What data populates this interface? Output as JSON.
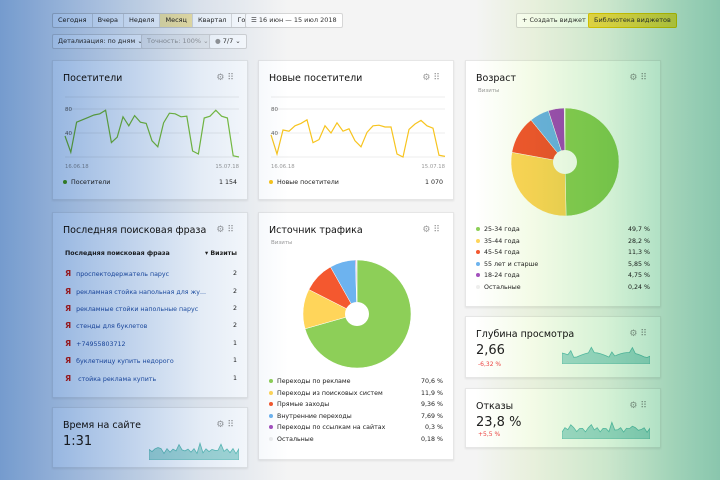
{
  "toolbar": {
    "periods": [
      "Сегодня",
      "Вчера",
      "Неделя",
      "Месяц",
      "Квартал",
      "Год"
    ],
    "active_period": "Месяц",
    "date_range": "16 июн — 15 июл 2018",
    "create_widget": "Создать виджет",
    "library": "Библиотека виджетов",
    "detail": "Детализация: по дням",
    "accuracy": "Точность: 100%",
    "segments": "7/7"
  },
  "visitors": {
    "title": "Посетители",
    "y_ticks": [
      "80",
      "40"
    ],
    "x_start": "16.06.18",
    "x_end": "15.07.18",
    "legend": "Посетители",
    "total": "1 154",
    "color": "#7cc243",
    "values": [
      35,
      8,
      58,
      62,
      66,
      70,
      72,
      78,
      24,
      33,
      67,
      52,
      69,
      58,
      56,
      27,
      17,
      57,
      73,
      72,
      67,
      68,
      10,
      5,
      65,
      68,
      78,
      68,
      65,
      2,
      0
    ]
  },
  "new_visitors": {
    "title": "Новые посетители",
    "y_ticks": [
      "80",
      "40"
    ],
    "x_start": "16.06.18",
    "x_end": "15.07.18",
    "legend": "Новые посетители",
    "total": "1 070",
    "color": "#f7c41f",
    "values": [
      37,
      5,
      45,
      43,
      52,
      56,
      62,
      24,
      29,
      52,
      40,
      57,
      43,
      47,
      27,
      17,
      41,
      52,
      53,
      50,
      50,
      5,
      0,
      46,
      55,
      61,
      52,
      48,
      3,
      1
    ]
  },
  "search": {
    "title": "Последняя поисковая фраза",
    "col_phrase": "Последняя поисковая фраза",
    "col_visits": "▾ Визиты",
    "rows": [
      {
        "phrase": "проспектодержатель парус",
        "visits": "2"
      },
      {
        "phrase": "рекламная стойка напольная для жу...",
        "visits": "2"
      },
      {
        "phrase": "рекламные стойки напольные парус",
        "visits": "2"
      },
      {
        "phrase": "стенды для буклетов",
        "visits": "2"
      },
      {
        "phrase": "+74955803712",
        "visits": "1"
      },
      {
        "phrase": "буклетницу купить недорого",
        "visits": "1"
      },
      {
        "phrase": " стойка реклама купить",
        "visits": "1"
      }
    ]
  },
  "time": {
    "title": "Время на сайте",
    "value": "1:31"
  },
  "traffic": {
    "title": "Источник трафика",
    "subtitle": "Визиты",
    "items": [
      {
        "label": "Переходы по рекламе",
        "value": "70,6 %",
        "pct": 70.6,
        "color": "#8dcf58"
      },
      {
        "label": "Переходы из поисковых систем",
        "value": "11,9 %",
        "pct": 11.9,
        "color": "#ffd55a"
      },
      {
        "label": "Прямые заходы",
        "value": "9,36 %",
        "pct": 9.36,
        "color": "#f4582f"
      },
      {
        "label": "Внутренние переходы",
        "value": "7,69 %",
        "pct": 7.69,
        "color": "#6db3ef"
      },
      {
        "label": "Переходы по ссылкам на сайтах",
        "value": "0,3 %",
        "pct": 0.3,
        "color": "#a351be"
      },
      {
        "label": "Остальные",
        "value": "0,18 %",
        "pct": 0.18,
        "color": "#eeeeee"
      }
    ]
  },
  "age": {
    "title": "Возраст",
    "subtitle": "Визиты",
    "items": [
      {
        "label": "25-34 года",
        "value": "49,7 %",
        "pct": 49.7,
        "color": "#8dcf58"
      },
      {
        "label": "35-44 года",
        "value": "28,2 %",
        "pct": 28.2,
        "color": "#ffd55a"
      },
      {
        "label": "45-54 года",
        "value": "11,3 %",
        "pct": 11.3,
        "color": "#f4582f"
      },
      {
        "label": "55 лет и старше",
        "value": "5,85 %",
        "pct": 5.85,
        "color": "#6db3ef"
      },
      {
        "label": "18-24 года",
        "value": "4,75 %",
        "pct": 4.75,
        "color": "#a351be"
      },
      {
        "label": "Остальные",
        "value": "0,24 %",
        "pct": 0.24,
        "color": "#eeeeee"
      }
    ]
  },
  "depth": {
    "title": "Глубина просмотра",
    "value": "2,66",
    "delta": "-6,32 %"
  },
  "bounce": {
    "title": "Отказы",
    "value": "23,8 %",
    "delta": "+5,5 %"
  },
  "spark_color": "#5fc0b8"
}
